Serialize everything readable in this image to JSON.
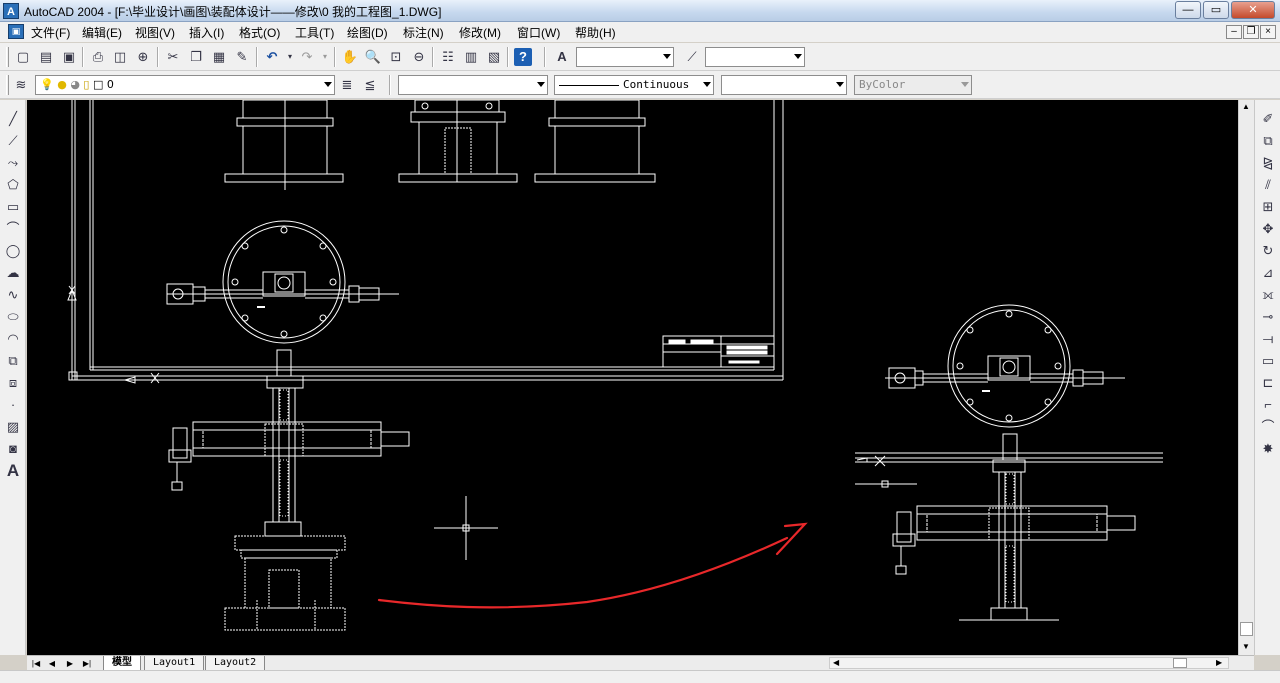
{
  "window": {
    "title": "AutoCAD 2004 - [F:\\毕业设计\\画图\\装配体设计——修改\\0 我的工程图_1.DWG]",
    "app_icon": "autocad-app-icon",
    "controls": [
      "minimize-icon",
      "restore-icon",
      "close-icon"
    ],
    "control_glyphs": {
      "min": "—",
      "restore": "▭",
      "close": "✕"
    },
    "doc_control_glyphs": {
      "min": "–",
      "restore": "❐",
      "close": "×"
    }
  },
  "menu": {
    "items": [
      "文件(F)",
      "编辑(E)",
      "视图(V)",
      "插入(I)",
      "格式(O)",
      "工具(T)",
      "绘图(D)",
      "标注(N)",
      "修改(M)",
      "窗口(W)",
      "帮助(H)"
    ]
  },
  "standard_toolbar": {
    "icons": [
      "new-icon",
      "open-icon",
      "save-icon",
      "print-icon",
      "preview-icon",
      "publish-icon",
      "cut-icon",
      "copy-icon",
      "paste-icon",
      "matchprop-icon",
      "undo-icon",
      "redo-icon",
      "pan-icon",
      "zoom-realtime-icon",
      "zoom-window-icon",
      "zoom-previous-icon",
      "properties-icon",
      "designcenter-icon",
      "toolpalettes-icon",
      "help-icon"
    ],
    "text_style_combo": "",
    "dim_style_combo": ""
  },
  "layers_toolbar": {
    "layer_name": "0",
    "linetype": "Continuous",
    "color_combo_1": "",
    "color_combo_2": "",
    "lineweight": "",
    "plotstyle": "ByColor"
  },
  "draw_toolbar": {
    "icons": [
      "line-icon",
      "xline-icon",
      "polyline-icon",
      "polygon-icon",
      "rectangle-icon",
      "arc-icon",
      "circle-icon",
      "revcloud-icon",
      "spline-icon",
      "ellipse-icon",
      "ellipse-arc-icon",
      "insert-block-icon",
      "make-block-icon",
      "point-icon",
      "hatch-icon",
      "region-icon",
      "mtext-icon"
    ],
    "mtext_glyph": "A"
  },
  "modify_toolbar": {
    "icons": [
      "erase-icon",
      "copy-object-icon",
      "mirror-icon",
      "offset-icon",
      "array-icon",
      "move-icon",
      "rotate-icon",
      "scale-icon",
      "stretch-icon",
      "trim-icon",
      "extend-icon",
      "break-icon",
      "break-at-point-icon",
      "chamfer-icon",
      "fillet-icon",
      "explode-icon"
    ]
  },
  "layout_tabs": {
    "tabs": [
      "模型",
      "Layout1",
      "Layout2"
    ],
    "active": "模型"
  },
  "drawing": {
    "title_block_label": "",
    "annotation_color": "#e8282a",
    "crosshair": true
  }
}
